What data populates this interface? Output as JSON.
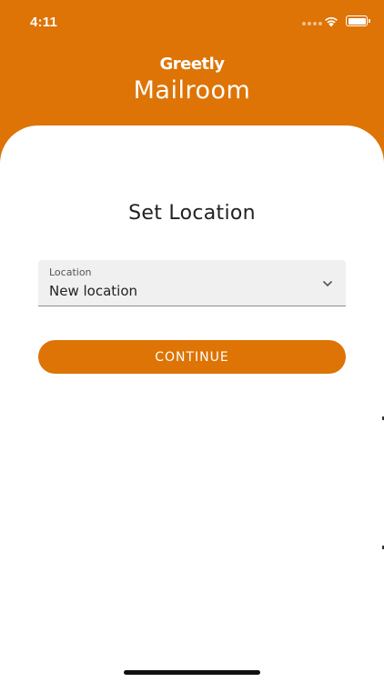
{
  "status_bar": {
    "time": "4:11",
    "icons": [
      "signal-icon",
      "wifi-icon",
      "battery-icon"
    ]
  },
  "header": {
    "brand": "Greetly",
    "app_title": "Mailroom"
  },
  "main": {
    "title": "Set Location",
    "location_select": {
      "label": "Location",
      "value": "New location"
    },
    "continue_label": "CONTINUE"
  },
  "colors": {
    "brand_orange": "#dd7405",
    "field_background": "#f0f0f0",
    "text_dark": "#222222"
  }
}
